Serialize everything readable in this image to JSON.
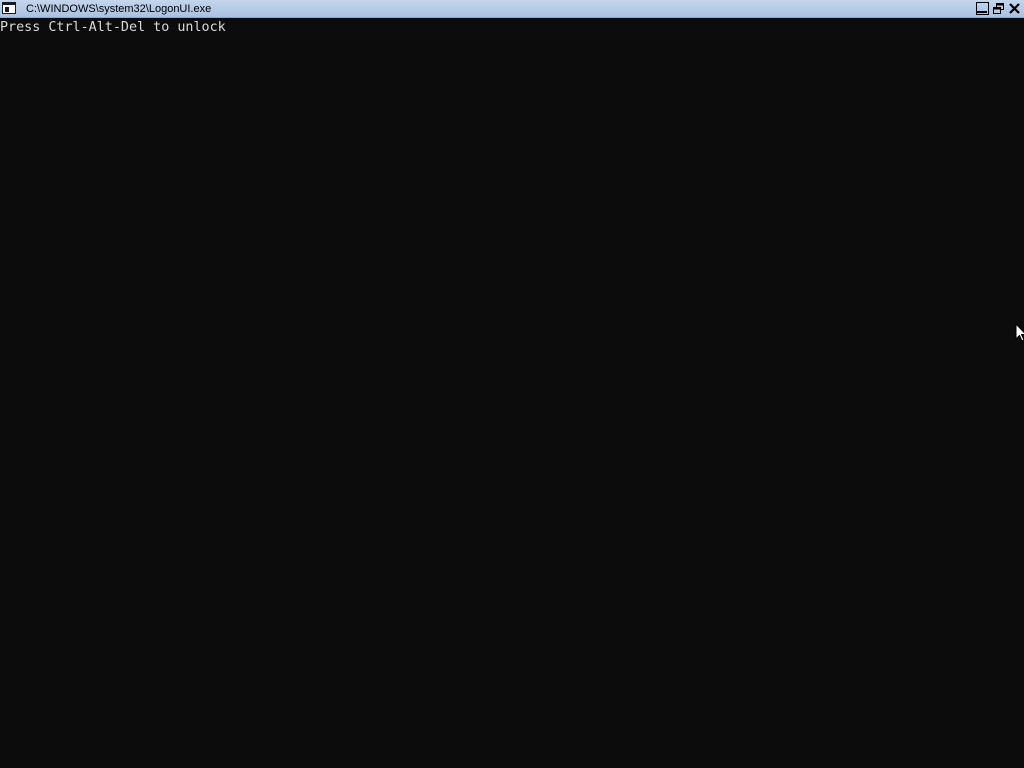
{
  "window": {
    "title": "C:\\WINDOWS\\system32\\LogonUI.exe",
    "icon": "console-window-icon",
    "controls": {
      "minimize": "minimize-icon",
      "restore": "restore-icon",
      "close": "close-icon"
    }
  },
  "console": {
    "message": "Press Ctrl-Alt-Del to unlock",
    "background_color": "#0c0c0c",
    "text_color": "#d9d9d9"
  },
  "colors": {
    "titlebar": "#b6cbe6"
  }
}
